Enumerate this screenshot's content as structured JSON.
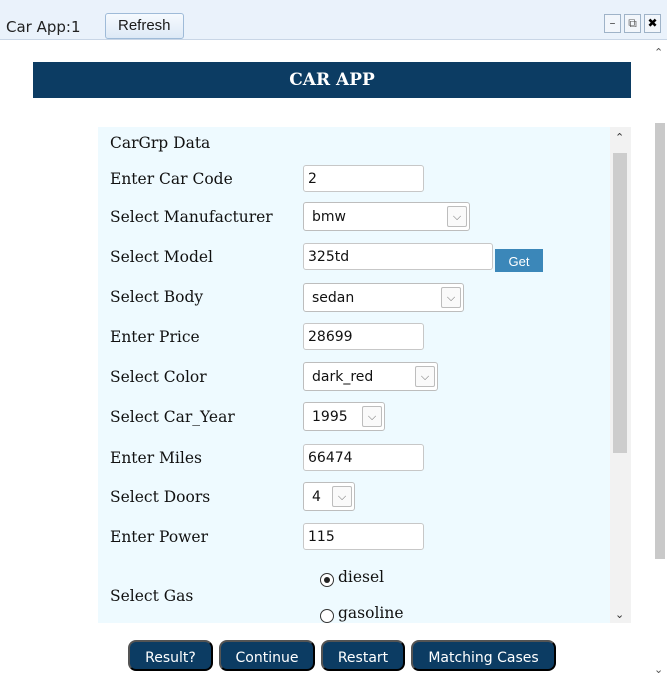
{
  "window": {
    "title": "Car App:1",
    "refresh_label": "Refresh",
    "minimize_glyph": "–",
    "popout_glyph": "⧉",
    "close_glyph": "✖"
  },
  "header": {
    "title": "CAR APP"
  },
  "form": {
    "section_title": "CarGrp Data",
    "car_code": {
      "label": "Enter Car Code",
      "value": "2"
    },
    "manufacturer": {
      "label": "Select Manufacturer",
      "value": "bmw"
    },
    "model": {
      "label": "Select Model",
      "value": "325td",
      "get_label": "Get"
    },
    "body": {
      "label": "Select Body",
      "value": "sedan"
    },
    "price": {
      "label": "Enter Price",
      "value": "28699"
    },
    "color": {
      "label": "Select Color",
      "value": "dark_red"
    },
    "car_year": {
      "label": "Select Car_Year",
      "value": "1995"
    },
    "miles": {
      "label": "Enter Miles",
      "value": "66474"
    },
    "doors": {
      "label": "Select Doors",
      "value": "4"
    },
    "power": {
      "label": "Enter Power",
      "value": "115"
    },
    "gas": {
      "label": "Select Gas",
      "options": [
        "diesel",
        "gasoline"
      ],
      "selected": "diesel"
    }
  },
  "buttons": {
    "result": "Result?",
    "continue": "Continue",
    "restart": "Restart",
    "matching": "Matching Cases"
  },
  "icons": {
    "chevron": "chevron-down-icon",
    "scroll_up": "chevron-up-icon",
    "scroll_down": "chevron-down-icon"
  }
}
